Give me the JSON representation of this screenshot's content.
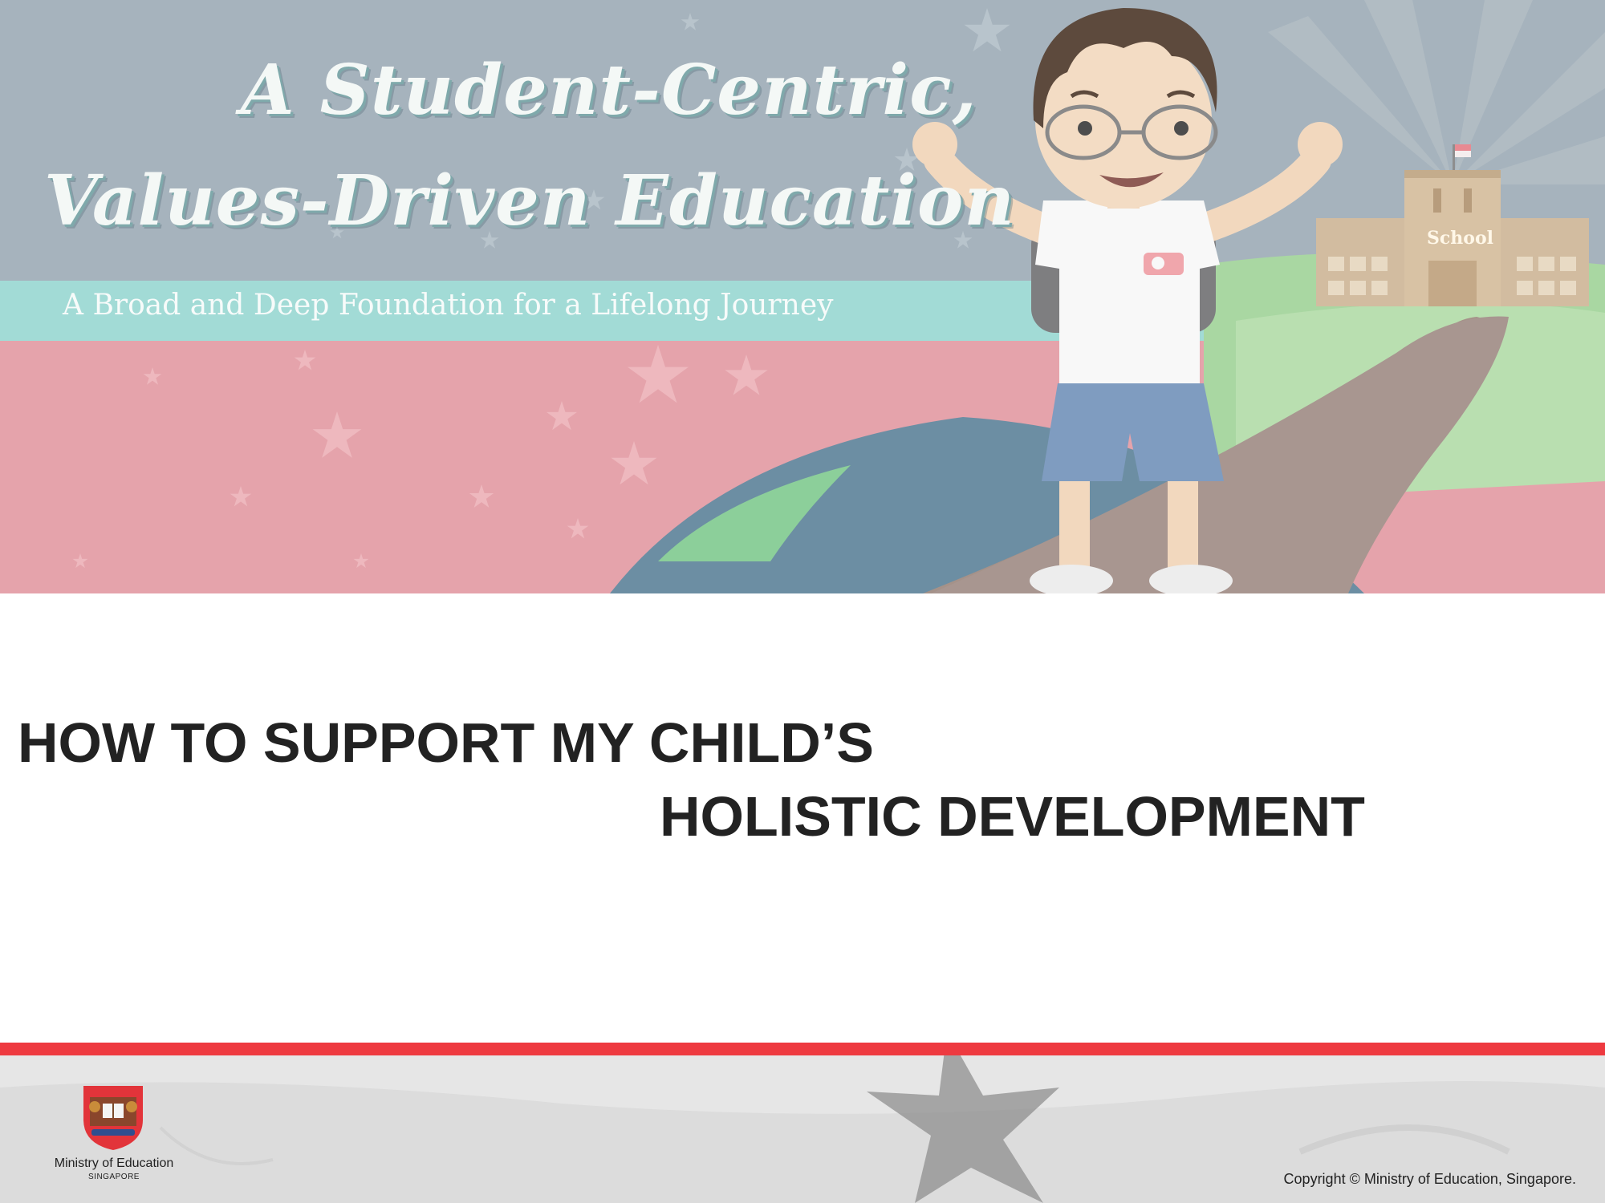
{
  "banner": {
    "headline_line1": "A Student-Centric,",
    "headline_line2": "Values-Driven Education",
    "tagline": "A Broad and Deep Foundation for a Lifelong Journey",
    "school_sign": "School"
  },
  "title": {
    "line1": "HOW TO SUPPORT MY CHILD’S",
    "line2": "HOLISTIC DEVELOPMENT"
  },
  "footer": {
    "ministry_name": "Ministry of Education",
    "ministry_country": "SINGAPORE",
    "copyright": "Copyright © Ministry of Education, Singapore."
  },
  "colors": {
    "banner_sky": "#a6b3bd",
    "banner_teal": "#a2dbd6",
    "banner_red": "#e5a3ab",
    "title_text": "#222222",
    "footer_rule": "#ee3a40",
    "footer_bg": "#e4e4e4"
  },
  "icons": {
    "crest": "moe-crest-icon",
    "star": "star-icon"
  }
}
